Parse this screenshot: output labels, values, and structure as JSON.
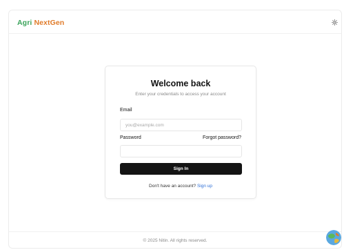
{
  "header": {
    "brand_part1": "Agri",
    "brand_part2": "NextGen",
    "theme_icon": "sun-icon"
  },
  "login": {
    "title": "Welcome back",
    "subtitle": "Enter your credentials to access your account",
    "email_label": "Email",
    "email_placeholder": "you@example.com",
    "email_value": "",
    "password_label": "Password",
    "password_value": "",
    "forgot_label": "Forgot password?",
    "signin_label": "Sign In",
    "signup_prompt": "Don't have an account?",
    "signup_link": "Sign up"
  },
  "footer": {
    "copyright": "© 2025 Nitin. All rights reserved."
  },
  "colors": {
    "brand_green": "#3aa35a",
    "brand_orange": "#e07b2a",
    "button_bg": "#141414",
    "link": "#2f6fd6"
  }
}
